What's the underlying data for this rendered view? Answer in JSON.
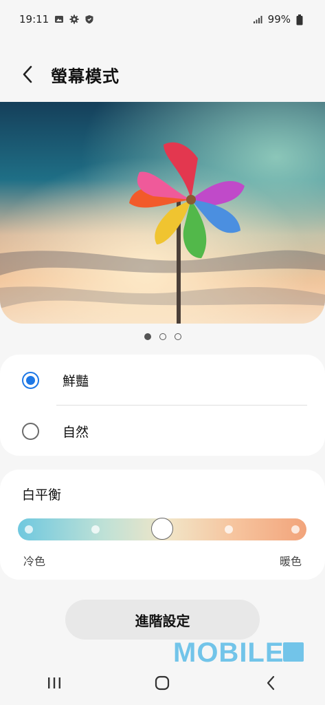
{
  "status_bar": {
    "time": "19:11",
    "battery": "99%",
    "left_icons": [
      "image-icon",
      "gear-icon",
      "shield-icon"
    ],
    "right_icons": [
      "signal-icon",
      "battery-icon"
    ]
  },
  "header": {
    "title": "螢幕模式",
    "back_icon": "chevron-left-icon"
  },
  "preview": {
    "image": "colorful pinwheel against sunset sky",
    "page_count": 3,
    "active_page": 1
  },
  "modes": {
    "selected": "vivid",
    "items": [
      {
        "id": "vivid",
        "label": "鮮豔",
        "selected": true
      },
      {
        "id": "natural",
        "label": "自然",
        "selected": false
      }
    ]
  },
  "white_balance": {
    "title": "白平衡",
    "cold_label": "冷色",
    "warm_label": "暖色",
    "value": 0.5,
    "steps": 5,
    "colors": {
      "cold": "#6fc8df",
      "warm": "#f2a47b"
    }
  },
  "advanced_button": {
    "label": "進階設定"
  },
  "watermark": {
    "text": "MOBILE"
  },
  "nav_bar": {
    "icons": [
      "recent-apps-icon",
      "home-icon",
      "back-icon"
    ]
  },
  "colors": {
    "accent": "#1e78e6",
    "background": "#f6f6f6",
    "card": "#ffffff"
  }
}
